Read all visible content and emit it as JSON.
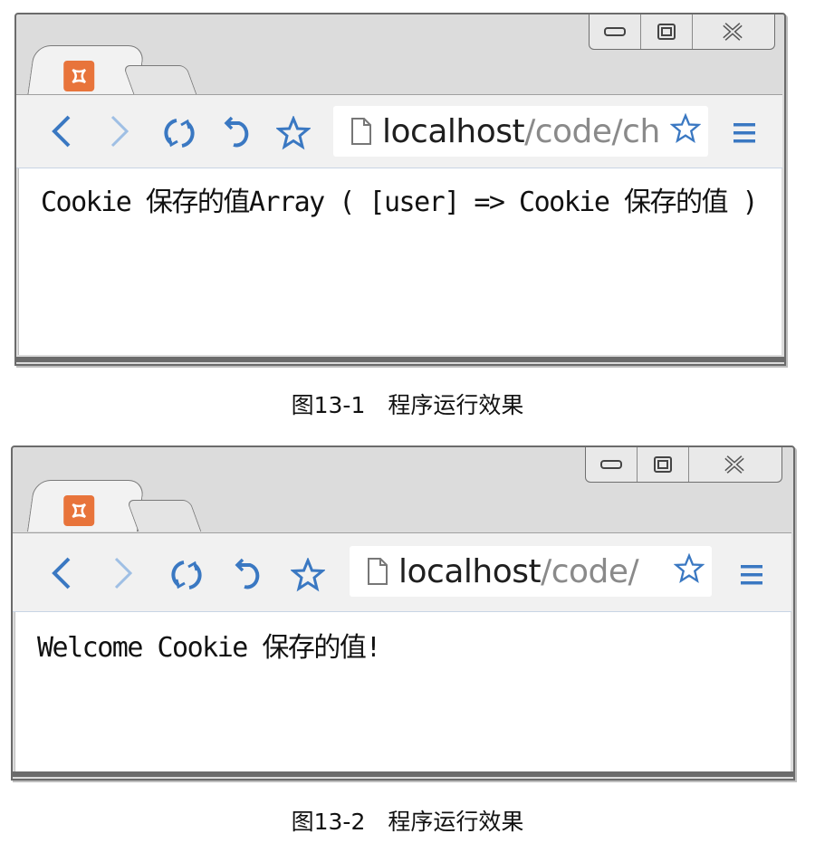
{
  "windows": [
    {
      "url_host": "localhost",
      "url_path": "/code/ch",
      "content_text": "Cookie 保存的值Array ( [user] => Cookie 保存的值 )",
      "figure_caption": "图13-1　程序运行效果"
    },
    {
      "url_host": "localhost",
      "url_path": "/code/",
      "content_text": "Welcome Cookie 保存的值!",
      "figure_caption": "图13-2　程序运行效果"
    }
  ],
  "icons": {
    "back": "chevron-left-icon",
    "forward": "chevron-right-icon",
    "reload": "reload-icon",
    "undo": "undo-icon",
    "bookmark": "star-icon",
    "page": "page-icon",
    "menu": "hamburger-menu-icon",
    "tab": "xampp-icon"
  },
  "colors": {
    "accent": "#3a78c2",
    "tab_icon": "#e8743b"
  }
}
